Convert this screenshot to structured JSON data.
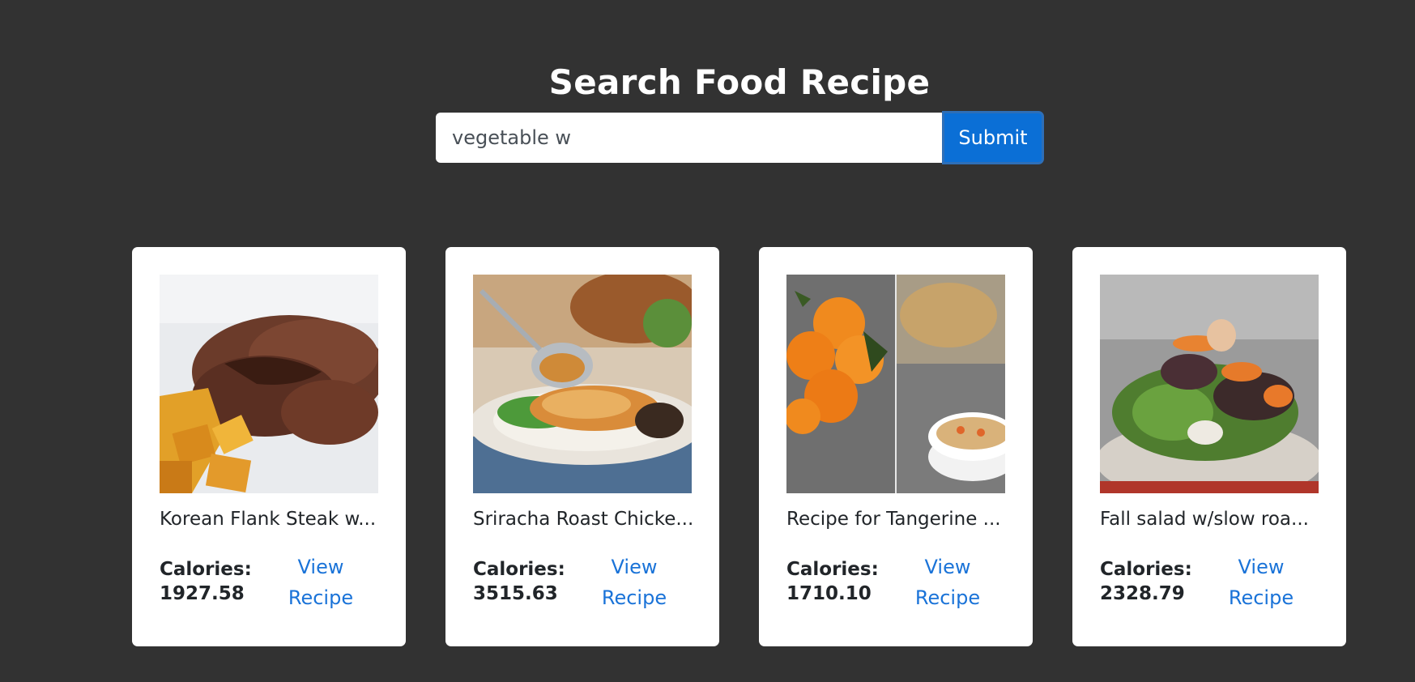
{
  "header": {
    "title": "Search Food Recipe"
  },
  "search": {
    "value": "vegetable w",
    "submit_label": "Submit"
  },
  "colors": {
    "background": "#323232",
    "accent": "#0b6fd6",
    "link": "#1a73d8"
  },
  "recipes": [
    {
      "title": "Korean Flank Steak w...",
      "calories_label": "Calories:",
      "calories_value": "1927.58",
      "link_line1": "View",
      "link_line2": "Recipe"
    },
    {
      "title": "Sriracha Roast Chicke...",
      "calories_label": "Calories:",
      "calories_value": "3515.63",
      "link_line1": "View",
      "link_line2": "Recipe"
    },
    {
      "title": "Recipe for Tangerine ...",
      "calories_label": "Calories:",
      "calories_value": "1710.10",
      "link_line1": "View",
      "link_line2": "Recipe"
    },
    {
      "title": "Fall salad w/slow roa...",
      "calories_label": "Calories:",
      "calories_value": "2328.79",
      "link_line1": "View",
      "link_line2": "Recipe"
    }
  ]
}
